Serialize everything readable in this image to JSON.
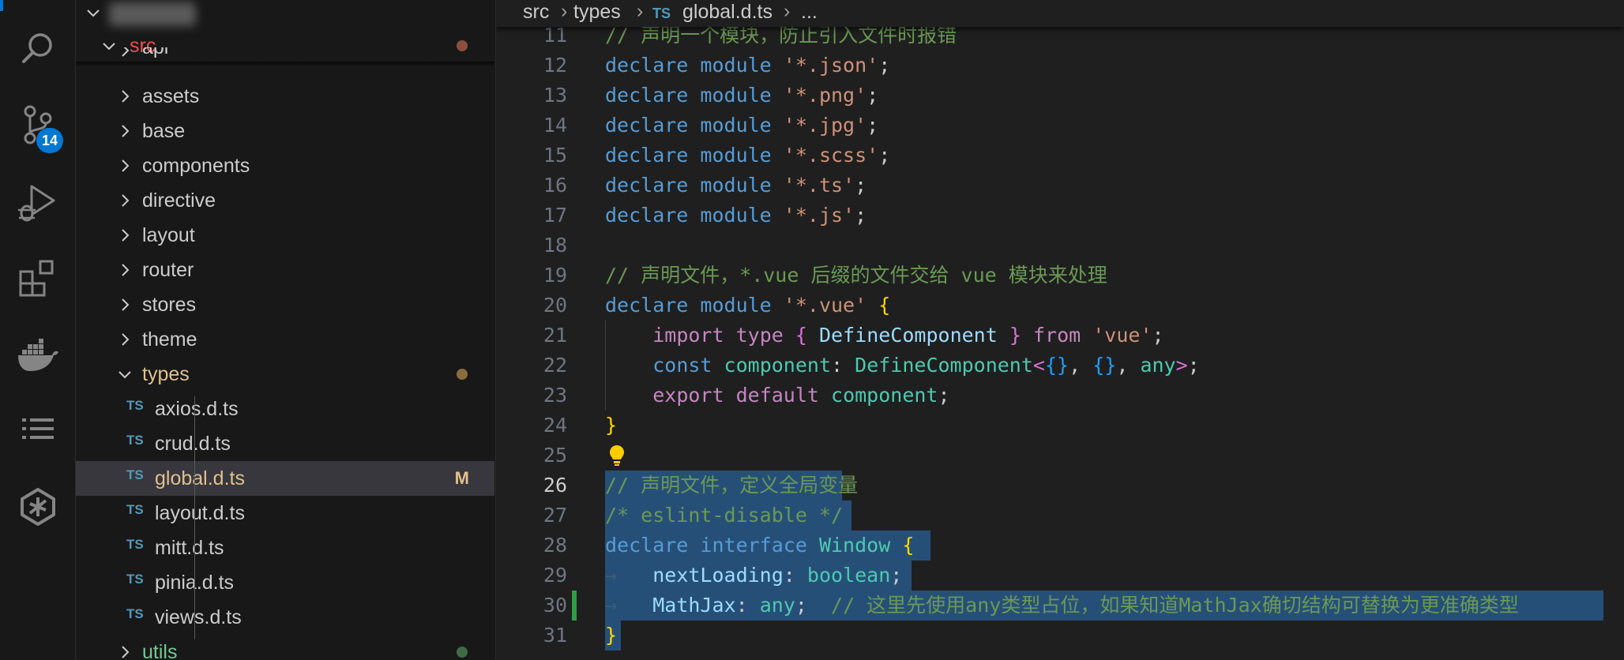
{
  "activity_bar": {
    "icons": [
      "search-icon",
      "source-control-icon",
      "run-debug-icon",
      "extensions-icon",
      "docker-icon",
      "list-icon",
      "ai-assistant-icon"
    ],
    "scm_badge": "14",
    "accent": "#0078d4"
  },
  "explorer": {
    "root_label": "",
    "src_label": "src",
    "items": [
      {
        "label": "api",
        "type": "folder"
      },
      {
        "label": "assets",
        "type": "folder"
      },
      {
        "label": "base",
        "type": "folder"
      },
      {
        "label": "components",
        "type": "folder"
      },
      {
        "label": "directive",
        "type": "folder"
      },
      {
        "label": "layout",
        "type": "folder"
      },
      {
        "label": "router",
        "type": "folder"
      },
      {
        "label": "stores",
        "type": "folder"
      },
      {
        "label": "theme",
        "type": "folder"
      },
      {
        "label": "types",
        "type": "folder-open"
      },
      {
        "label": "axios.d.ts",
        "type": "file"
      },
      {
        "label": "crud.d.ts",
        "type": "file"
      },
      {
        "label": "global.d.ts",
        "type": "file",
        "selected": true,
        "status": "M"
      },
      {
        "label": "layout.d.ts",
        "type": "file"
      },
      {
        "label": "mitt.d.ts",
        "type": "file"
      },
      {
        "label": "pinia.d.ts",
        "type": "file"
      },
      {
        "label": "views.d.ts",
        "type": "file"
      },
      {
        "label": "utils",
        "type": "folder"
      }
    ],
    "file_badge": "TS",
    "status_colors": {
      "modified": "#e2c08d",
      "untracked": "#73c991",
      "dot": "#8c6c3e"
    }
  },
  "breadcrumb": {
    "parts": [
      "src",
      "types",
      "global.d.ts",
      "..."
    ],
    "file_badge": "TS"
  },
  "editor": {
    "line_numbers": [
      "11",
      "12",
      "13",
      "14",
      "15",
      "16",
      "17",
      "18",
      "19",
      "20",
      "21",
      "22",
      "23",
      "24",
      "25",
      "26",
      "27",
      "28",
      "29",
      "30",
      "31"
    ],
    "active_line": "26",
    "lines": {
      "l11": "// 声明一个模块，防止引入文件时报错",
      "l12_mod": "'*.json'",
      "l13_mod": "'*.png'",
      "l14_mod": "'*.jpg'",
      "l15_mod": "'*.scss'",
      "l16_mod": "'*.ts'",
      "l17_mod": "'*.js'",
      "l19": "// 声明文件，*.vue 后缀的文件交给 vue 模块来处理",
      "l20_mod": "'*.vue'",
      "l21_import": "DefineComponent",
      "l21_from": "'vue'",
      "l22_name": "component",
      "l22_type": "DefineComponent",
      "l23_name": "component",
      "l26": "// 声明文件，定义全局变量",
      "l27": "/* eslint-disable */",
      "l28_name": "Window",
      "l29_prop": "nextLoading",
      "l29_type": "boolean",
      "l30_prop": "MathJax",
      "l30_type": "any",
      "l30_comment": "// 这里先使用any类型占位，如果知道MathJax确切结构可替换为更准确类型"
    },
    "keywords": {
      "declare": "declare",
      "module": "module",
      "import": "import",
      "type": "type",
      "from": "from",
      "const": "const",
      "any": "any",
      "export": "export",
      "default": "default",
      "interface": "interface"
    },
    "punct": {
      "semi": ";",
      "open": "{",
      "close": "}",
      "colon": ":",
      "comma": ",",
      "lt": "<",
      "gt": ">",
      "empty": "{}"
    },
    "whitespace_arrow": "→",
    "lightbulb": "lightbulb-icon"
  }
}
